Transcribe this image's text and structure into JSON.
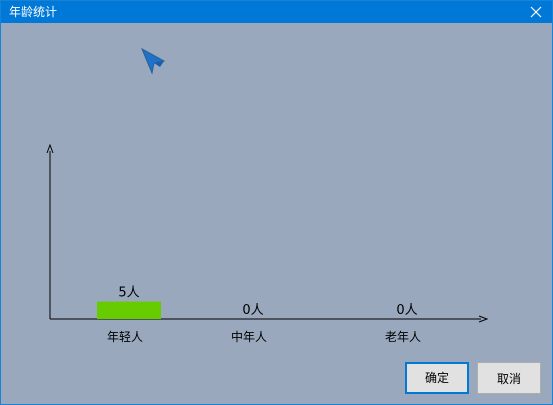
{
  "window": {
    "title": "年龄统计"
  },
  "icons": {
    "close": "close-icon",
    "cursor": "arrow-cursor-icon"
  },
  "colors": {
    "titlebar": "#0078d7",
    "background": "#9aa8be",
    "bar": "#66cc00"
  },
  "chart_data": {
    "type": "bar",
    "categories": [
      "年轻人",
      "中年人",
      "老年人"
    ],
    "values": [
      5,
      0,
      0
    ],
    "data_labels": [
      "5人",
      "0人",
      "0人"
    ],
    "ylim": [
      0,
      50
    ]
  },
  "buttons": {
    "ok_label": "确定",
    "cancel_label": "取消"
  }
}
